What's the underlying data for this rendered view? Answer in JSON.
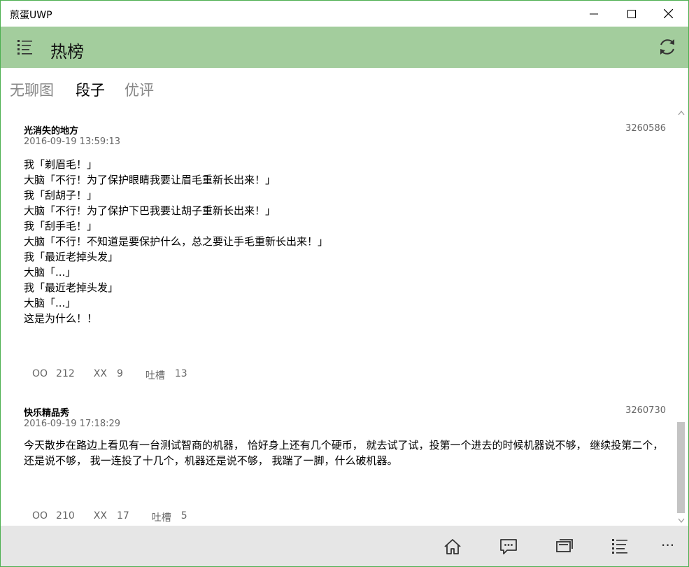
{
  "window": {
    "title": "煎蛋UWP"
  },
  "icons": {
    "minimize": "minimize-icon",
    "maximize": "maximize-icon",
    "close": "close-icon",
    "menu": "hamburger-list-icon",
    "refresh": "refresh-icon",
    "home": "home-icon",
    "comment": "comment-icon",
    "gallery": "gallery-icon",
    "list": "list-icon",
    "more": "more-icon"
  },
  "header": {
    "title": "热榜"
  },
  "pivot": {
    "tabs": [
      {
        "label": "无聊图",
        "selected": false
      },
      {
        "label": "段子",
        "selected": true
      },
      {
        "label": "优评",
        "selected": false
      }
    ]
  },
  "posts": [
    {
      "author": "光消失的地方",
      "time": "2016-09-19 13:59:13",
      "id": "3260586",
      "body": "我「剃眉毛！」\n大脑「不行！为了保护眼睛我要让眉毛重新长出来！」\n我「刮胡子！」\n大脑「不行！为了保护下巴我要让胡子重新长出来！」\n我「刮手毛！」\n大脑「不行！不知道是要保护什么，总之要让手毛重新长出来！」\n我「最近老掉头发」\n大脑「...」\n我「最近老掉头发」\n大脑「...」\n这是为什么！！",
      "oo_label": "OO",
      "oo": "212",
      "xx_label": "XX",
      "xx": "9",
      "tucao_label": "吐槽",
      "tucao": "13"
    },
    {
      "author": "快乐精品秀",
      "time": "2016-09-19 17:18:29",
      "id": "3260730",
      "body": "今天散步在路边上看见有一台测试智商的机器， 恰好身上还有几个硬币， 就去试了试，投第一个进去的时候机器说不够， 继续投第二个， 还是说不够， 我一连投了十几个，机器还是说不够， 我踹了一脚，什么破机器。",
      "oo_label": "OO",
      "oo": "210",
      "xx_label": "XX",
      "xx": "17",
      "tucao_label": "吐槽",
      "tucao": "5"
    }
  ],
  "appbar": {
    "more_label": "···"
  },
  "colors": {
    "header_bg": "#a3cd9d",
    "window_border": "#4caf50",
    "appbar_bg": "#e6e6e6",
    "muted_text": "#666666",
    "tab_inactive": "#888888"
  }
}
